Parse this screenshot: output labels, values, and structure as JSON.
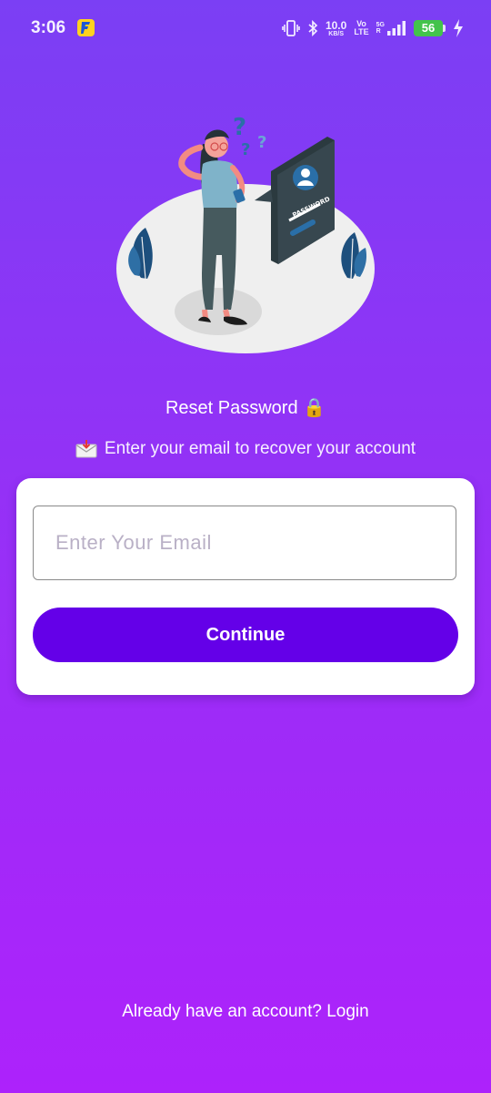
{
  "status_bar": {
    "time": "3:06",
    "speed_value": "10.0",
    "speed_unit": "KB/S",
    "volte_top": "Vo",
    "volte_bottom": "LTE",
    "network_top": "5G",
    "network_bottom": "R",
    "battery": "56",
    "icons": [
      "flipkart-icon",
      "vibrate-icon",
      "bluetooth-icon",
      "signal-icon",
      "charging-icon"
    ]
  },
  "illustration": {
    "label": "PASSWORD"
  },
  "header": {
    "title": "Reset Password 🔒",
    "subtitle": "Enter your email to recover your account"
  },
  "form": {
    "email_placeholder": "Enter Your Email",
    "email_value": "",
    "continue_label": "Continue"
  },
  "footer": {
    "login_text": "Already have an account? Login"
  },
  "colors": {
    "gradient_top": "#7b3ff4",
    "gradient_bottom": "#ad22fb",
    "button": "#6400e8",
    "battery": "#43c34b"
  }
}
